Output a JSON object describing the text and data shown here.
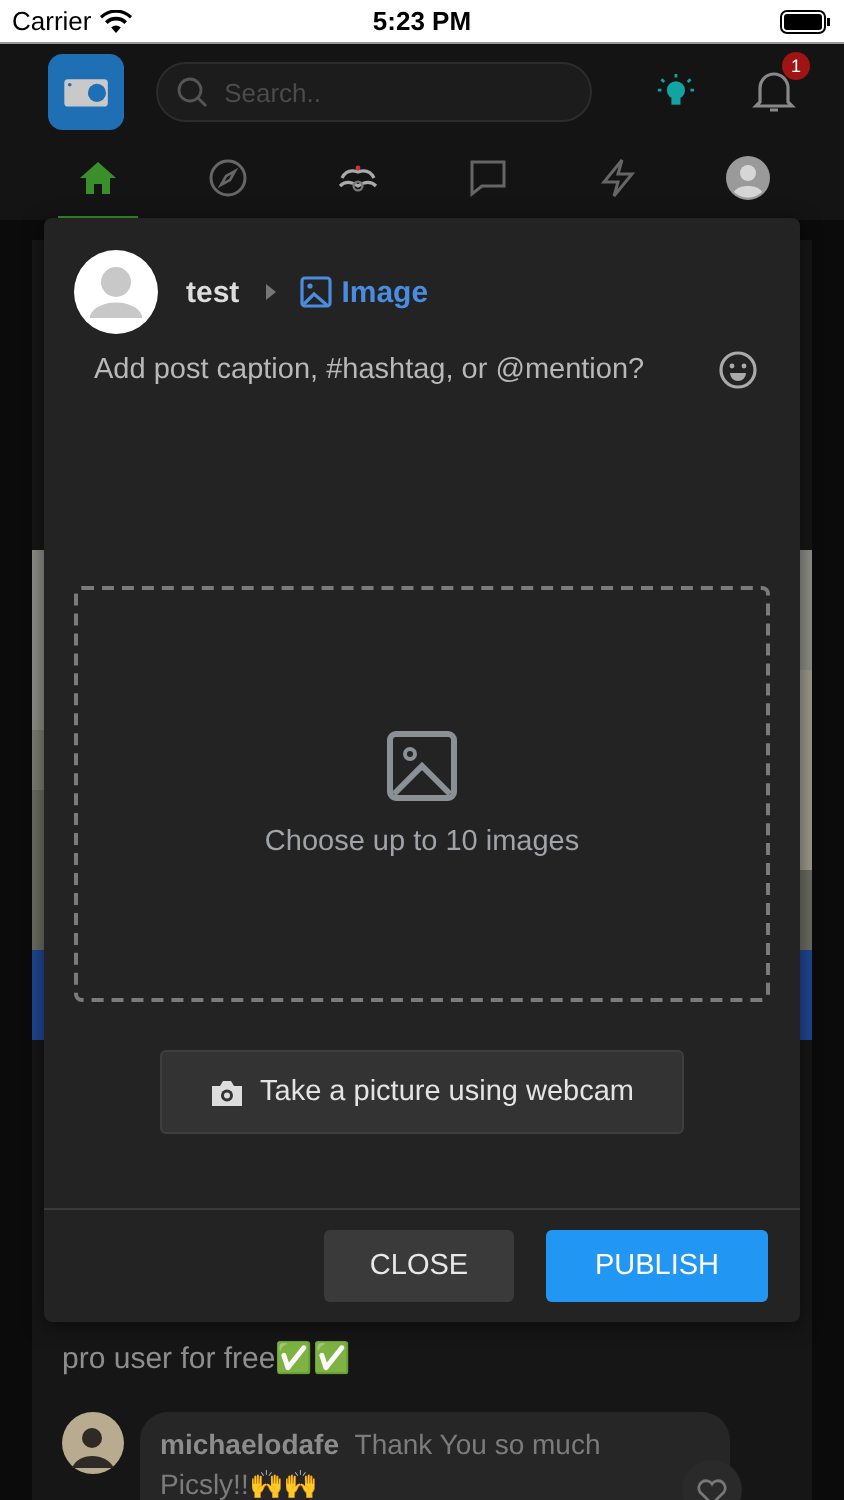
{
  "status_bar": {
    "carrier": "Carrier",
    "time": "5:23 PM"
  },
  "header": {
    "search": {
      "placeholder": "Search.."
    },
    "notifications": {
      "badge": "1"
    }
  },
  "nav": [
    {
      "kind": "home",
      "selected": true
    },
    {
      "kind": "explore",
      "selected": false
    },
    {
      "kind": "games",
      "selected": false
    },
    {
      "kind": "messages",
      "selected": false
    },
    {
      "kind": "activity",
      "selected": false
    },
    {
      "kind": "profile",
      "selected": false
    }
  ],
  "feed": {
    "post_text": "pro user for free✅✅",
    "comment": {
      "author": "michaelodafe",
      "text": "Thank You so much Picsly!!🙌🙌"
    }
  },
  "dialog": {
    "user": "test",
    "post_type": "Image",
    "caption": {
      "placeholder": "Add post caption, #hashtag, or @mention?"
    },
    "dropzone": "Choose up to 10 images",
    "webcam_button": "Take a picture using webcam",
    "buttons": [
      {
        "label": "CLOSE",
        "kind": "secondary"
      },
      {
        "label": "PUBLISH",
        "kind": "primary"
      }
    ]
  }
}
